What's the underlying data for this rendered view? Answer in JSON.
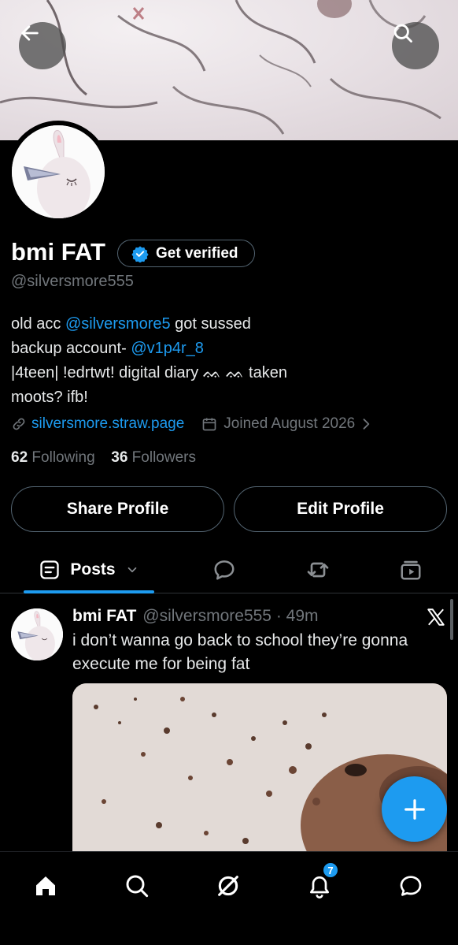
{
  "profile": {
    "name": "bmi FAT",
    "verify_label": "Get verified",
    "handle": "@silversmore555",
    "bio": {
      "line1_pre": "old acc ",
      "line1_mention": "@silversmore5",
      "line1_post": " got sussed",
      "line2_pre": "backup account- ",
      "line2_mention": "@v1p4r_8",
      "line3": "|4teen| !edrtwt! digital diary ᨐ ᨐ taken",
      "line4": "moots? ifb!"
    },
    "website": "silversmore.straw.page",
    "joined": "Joined August 2026",
    "following_count": "62",
    "following_label": "Following",
    "followers_count": "36",
    "followers_label": "Followers"
  },
  "actions": {
    "share_label": "Share Profile",
    "edit_label": "Edit Profile"
  },
  "tabs": {
    "posts_label": "Posts"
  },
  "post": {
    "author": "bmi FAT",
    "handle_time": "@silversmore555 · 49m",
    "text": "i don’t wanna go back to school they’re gonna execute me for being fat"
  },
  "nav": {
    "notifications_badge": "7"
  },
  "colors": {
    "accent": "#1d9bf0",
    "muted": "#71767b",
    "border": "#536471"
  }
}
